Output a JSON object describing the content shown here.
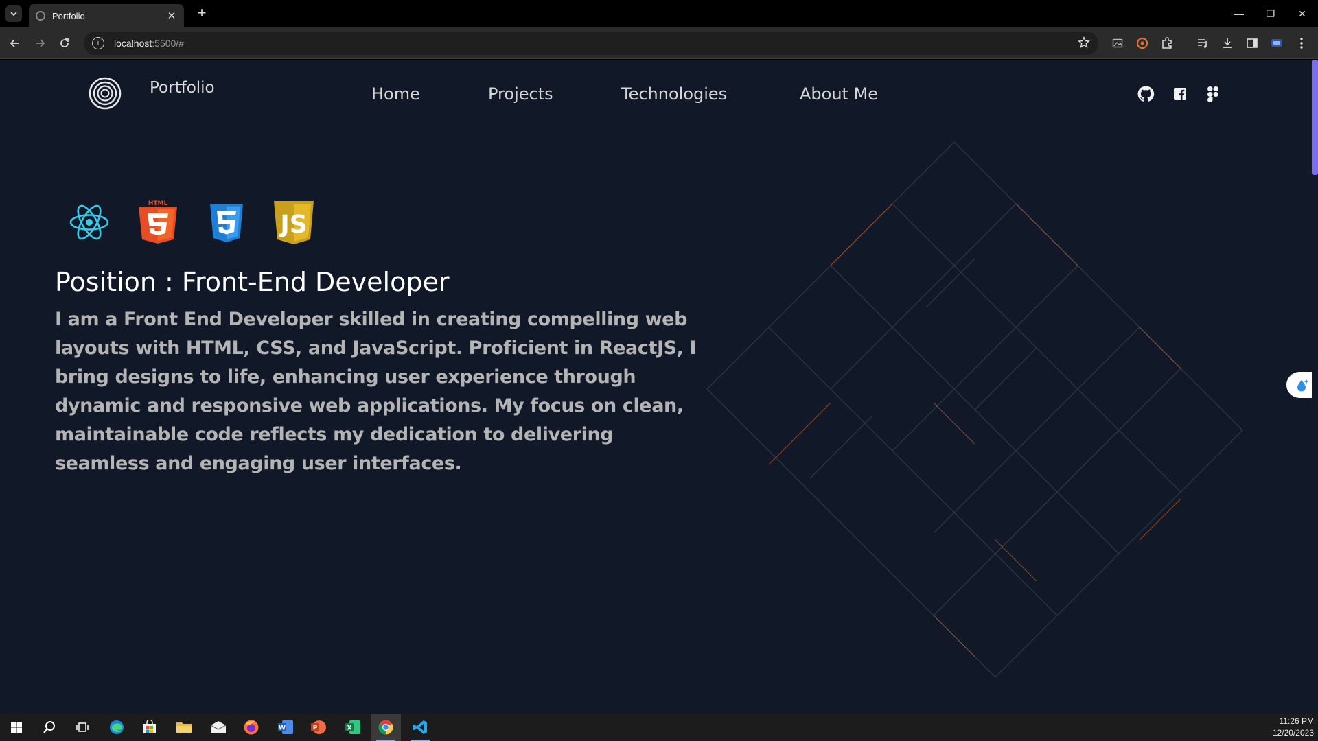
{
  "browser": {
    "tab": {
      "title": "Portfolio",
      "close": "✕"
    },
    "new_tab": "+",
    "window_controls": {
      "minimize": "—",
      "restore": "❐",
      "close": "✕"
    },
    "address": {
      "host": "localhost",
      "rest": ":5500/#"
    }
  },
  "site": {
    "brand": "Portfolio",
    "nav": [
      {
        "label": "Home"
      },
      {
        "label": "Projects"
      },
      {
        "label": "Technologies"
      },
      {
        "label": "About Me"
      }
    ],
    "social": [
      "github-icon",
      "facebook-icon",
      "figma-icon"
    ]
  },
  "hero": {
    "tech_icons": [
      "react-icon",
      "html5-icon",
      "css3-icon",
      "javascript-icon"
    ],
    "html_badge": "HTML",
    "js_badge": "JS",
    "title": "Position : Front-End Developer",
    "bio": "I am a Front End Developer skilled in creating compelling web layouts with HTML, CSS, and JavaScript. Proficient in ReactJS, I bring designs to life, enhancing user experience through dynamic and responsive web applications. My focus on clean, maintainable code reflects my dedication to delivering seamless and engaging user interfaces."
  },
  "taskbar": {
    "apps": [
      "start",
      "search",
      "task-view",
      "edge",
      "store",
      "file-explorer",
      "mail",
      "firefox",
      "word",
      "powerpoint",
      "excel",
      "chrome",
      "vscode"
    ],
    "time": "11:26 PM",
    "date": "12/20/2023"
  },
  "colors": {
    "page_bg": "#111827",
    "accent_scroll": "#7c6cf0",
    "line_gray": "#2f3646",
    "line_orange": "#c2591f"
  }
}
